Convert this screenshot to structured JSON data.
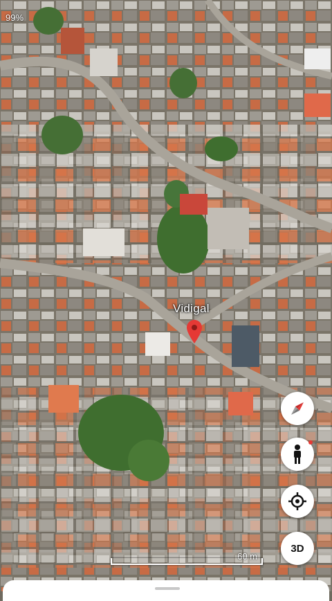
{
  "status": {
    "battery": "99%"
  },
  "map": {
    "place_label": "Vidigal",
    "scale_label": "60 m",
    "pin_color": "#e53935",
    "vegetation_color": "#3f6e2f",
    "roof_color": "#d2693e"
  },
  "controls": {
    "compass_icon": "compass-icon",
    "street_view_icon": "pegman-icon",
    "my_location_icon": "my-location-icon",
    "btn_3d_label": "3D"
  }
}
